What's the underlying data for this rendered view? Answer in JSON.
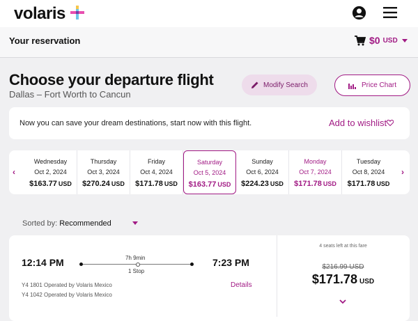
{
  "header": {
    "logo_text": "volaris",
    "icons": [
      "volaris-plus-logo",
      "account-icon",
      "menu-icon"
    ]
  },
  "reservation": {
    "title": "Your reservation",
    "cart_amount": "$0",
    "cart_currency": "USD"
  },
  "page": {
    "title": "Choose your departure flight",
    "route": "Dallas – Fort Worth to Cancun",
    "modify_label": "Modify Search",
    "price_chart_label": "Price Chart"
  },
  "wishlist": {
    "message": "Now you can save your dream destinations, start now with this flight.",
    "link": "Add to wishlist"
  },
  "dates": [
    {
      "day": "Wednesday",
      "date": "Oct 2, 2024",
      "price": "$163.77",
      "currency": "USD",
      "style": "normal"
    },
    {
      "day": "Thursday",
      "date": "Oct 3, 2024",
      "price": "$270.24",
      "currency": "USD",
      "style": "normal"
    },
    {
      "day": "Friday",
      "date": "Oct 4, 2024",
      "price": "$171.78",
      "currency": "USD",
      "style": "normal"
    },
    {
      "day": "Saturday",
      "date": "Oct 5, 2024",
      "price": "$163.77",
      "currency": "USD",
      "style": "selected"
    },
    {
      "day": "Sunday",
      "date": "Oct 6, 2024",
      "price": "$224.23",
      "currency": "USD",
      "style": "normal"
    },
    {
      "day": "Monday",
      "date": "Oct 7, 2024",
      "price": "$171.78",
      "currency": "USD",
      "style": "pink"
    },
    {
      "day": "Tuesday",
      "date": "Oct 8, 2024",
      "price": "$171.78",
      "currency": "USD",
      "style": "normal"
    }
  ],
  "sort": {
    "label": "Sorted by:",
    "value": "Recommended"
  },
  "flight": {
    "departure": "12:14 PM",
    "arrival": "7:23 PM",
    "duration": "7h 9min",
    "stops": "1 Stop",
    "operated_1": "Y4 1801 Operated by Volaris Mexico",
    "operated_2": "Y4 1042 Operated by Volaris Mexico",
    "details_label": "Details",
    "seats_left": "4 seats left at this fare",
    "old_price": "$216.99 USD",
    "price": "$171.78",
    "currency": "USD"
  },
  "colors": {
    "brand": "#a11a84",
    "background": "#f0f0f2"
  }
}
